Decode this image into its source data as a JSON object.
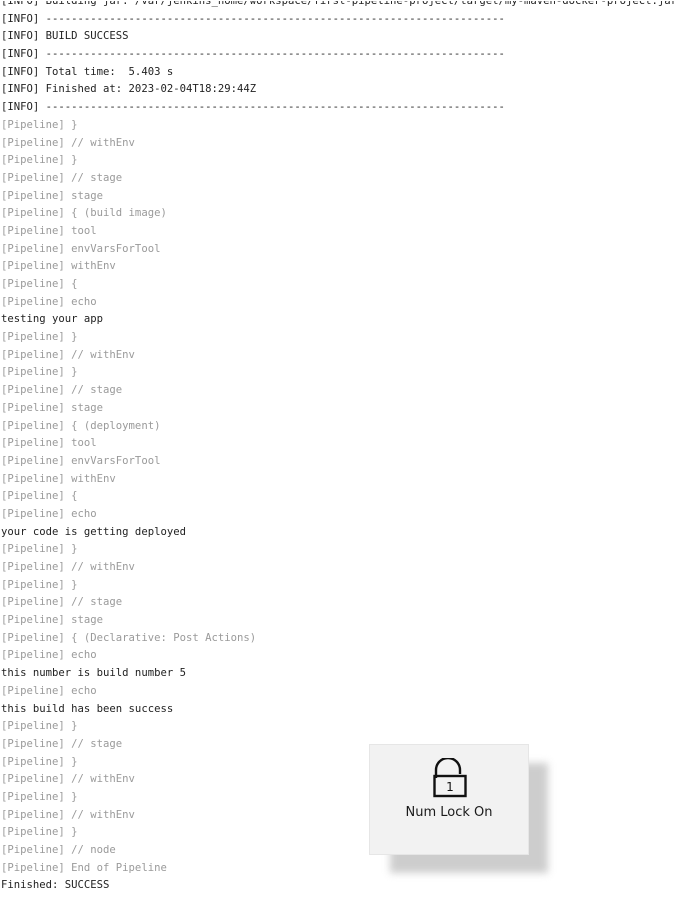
{
  "console": {
    "lines": [
      {
        "text": "[INFO] Building jar: /var/jenkins_home/workspace/first-pipeline-project/target/my-maven-docker-project.jar",
        "kind": "info"
      },
      {
        "text": "[INFO] ------------------------------------------------------------------------",
        "kind": "info"
      },
      {
        "text": "[INFO] BUILD SUCCESS",
        "kind": "info"
      },
      {
        "text": "[INFO] ------------------------------------------------------------------------",
        "kind": "info"
      },
      {
        "text": "[INFO] Total time:  5.403 s",
        "kind": "info"
      },
      {
        "text": "[INFO] Finished at: 2023-02-04T18:29:44Z",
        "kind": "info"
      },
      {
        "text": "[INFO] ------------------------------------------------------------------------",
        "kind": "info"
      },
      {
        "text": "[Pipeline] }",
        "kind": "pipeline"
      },
      {
        "text": "[Pipeline] // withEnv",
        "kind": "pipeline"
      },
      {
        "text": "[Pipeline] }",
        "kind": "pipeline"
      },
      {
        "text": "[Pipeline] // stage",
        "kind": "pipeline"
      },
      {
        "text": "[Pipeline] stage",
        "kind": "pipeline"
      },
      {
        "text": "[Pipeline] { (build image)",
        "kind": "pipeline"
      },
      {
        "text": "[Pipeline] tool",
        "kind": "pipeline"
      },
      {
        "text": "[Pipeline] envVarsForTool",
        "kind": "pipeline"
      },
      {
        "text": "[Pipeline] withEnv",
        "kind": "pipeline"
      },
      {
        "text": "[Pipeline] {",
        "kind": "pipeline"
      },
      {
        "text": "[Pipeline] echo",
        "kind": "pipeline"
      },
      {
        "text": "testing your app",
        "kind": "output"
      },
      {
        "text": "[Pipeline] }",
        "kind": "pipeline"
      },
      {
        "text": "[Pipeline] // withEnv",
        "kind": "pipeline"
      },
      {
        "text": "[Pipeline] }",
        "kind": "pipeline"
      },
      {
        "text": "[Pipeline] // stage",
        "kind": "pipeline"
      },
      {
        "text": "[Pipeline] stage",
        "kind": "pipeline"
      },
      {
        "text": "[Pipeline] { (deployment)",
        "kind": "pipeline"
      },
      {
        "text": "[Pipeline] tool",
        "kind": "pipeline"
      },
      {
        "text": "[Pipeline] envVarsForTool",
        "kind": "pipeline"
      },
      {
        "text": "[Pipeline] withEnv",
        "kind": "pipeline"
      },
      {
        "text": "[Pipeline] {",
        "kind": "pipeline"
      },
      {
        "text": "[Pipeline] echo",
        "kind": "pipeline"
      },
      {
        "text": "your code is getting deployed",
        "kind": "output"
      },
      {
        "text": "[Pipeline] }",
        "kind": "pipeline"
      },
      {
        "text": "[Pipeline] // withEnv",
        "kind": "pipeline"
      },
      {
        "text": "[Pipeline] }",
        "kind": "pipeline"
      },
      {
        "text": "[Pipeline] // stage",
        "kind": "pipeline"
      },
      {
        "text": "[Pipeline] stage",
        "kind": "pipeline"
      },
      {
        "text": "[Pipeline] { (Declarative: Post Actions)",
        "kind": "pipeline"
      },
      {
        "text": "[Pipeline] echo",
        "kind": "pipeline"
      },
      {
        "text": "this number is build number 5",
        "kind": "output"
      },
      {
        "text": "[Pipeline] echo",
        "kind": "pipeline"
      },
      {
        "text": "this build has been success",
        "kind": "output"
      },
      {
        "text": "[Pipeline] }",
        "kind": "pipeline"
      },
      {
        "text": "[Pipeline] // stage",
        "kind": "pipeline"
      },
      {
        "text": "[Pipeline] }",
        "kind": "pipeline"
      },
      {
        "text": "[Pipeline] // withEnv",
        "kind": "pipeline"
      },
      {
        "text": "[Pipeline] }",
        "kind": "pipeline"
      },
      {
        "text": "[Pipeline] // withEnv",
        "kind": "pipeline"
      },
      {
        "text": "[Pipeline] }",
        "kind": "pipeline"
      },
      {
        "text": "[Pipeline] // node",
        "kind": "pipeline"
      },
      {
        "text": "[Pipeline] End of Pipeline",
        "kind": "pipeline"
      },
      {
        "text": "Finished: SUCCESS",
        "kind": "output"
      }
    ]
  },
  "osd": {
    "icon": "unlocked-padlock-icon",
    "icon_digit": "1",
    "label": "Num Lock On"
  },
  "colors": {
    "pipeline_text": "#9a9a9a",
    "output_text": "#222222",
    "osd_background": "#f2f2f2"
  }
}
